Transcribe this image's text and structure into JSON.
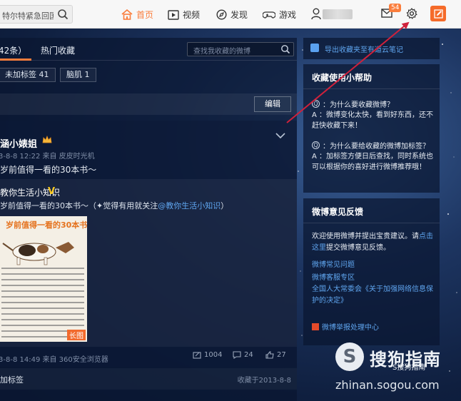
{
  "topbar": {
    "search_text": "特尔特紧急回国",
    "nav": {
      "home": "首页",
      "video": "视频",
      "discover": "发现",
      "game": "游戏"
    },
    "mail_badge": "54"
  },
  "main": {
    "tabs": [
      "42条）",
      "热门收藏"
    ],
    "fav_search_placeholder": "查找我收藏的微博",
    "tags": [
      "未加标签 41",
      "脑肌 1"
    ],
    "edit_label": "编辑",
    "post": {
      "author": "涵小婊姐",
      "meta": "3-8-8 12:22 来自 皮皮时光机",
      "text": "岁前值得一看的30本书～",
      "repost": {
        "author": "教你生活小知识",
        "v_badge": "V",
        "text_prefix": "岁前值得一看的30本书～（✦觉得有用就关注",
        "text_link": "@教你生活小知识",
        "text_suffix": "）",
        "thumb_title": "岁前值得一看的30本书",
        "long_tag": "长图"
      },
      "footer_meta": "3-8-8 14:49 来自 360安全浏览器",
      "repost_count": "1004",
      "comment_count": "24",
      "like_count": "27"
    },
    "tag_footer_left": "加标签",
    "tag_footer_right": "收藏于2013-8-8"
  },
  "sidebar": {
    "export_text": "导出收藏夹至有道云笔记",
    "help": {
      "title": "收藏使用小帮助",
      "q1": "：为什么要收藏微博？",
      "a1": "A ：微博变化太快，看到好东西，还不赶快收藏下来！",
      "q2": "：为什么要给收藏的微博加标签？",
      "a2": "A ：加标签方便日后查找，同时系统也可以根据你的喜好进行微博推荐哦！"
    },
    "feedback": {
      "title": "微博意见反馈",
      "text_prefix": "欢迎使用微博并提出宝贵建议。请",
      "text_link": "点击这里",
      "text_suffix": "提交微博意见反馈。",
      "link1": "微博常见问题",
      "link2": "微博客服专区",
      "law": "全国人大常委会《关于加强网络信息保护的决定》",
      "report": "微博举报处理中心"
    }
  },
  "watermark": {
    "logo": "S",
    "brand": "搜狗指南",
    "small": "S搜狗指南",
    "url": "zhinan.sogou.com"
  },
  "colors": {
    "accent": "#fa7d3c",
    "link": "#5fa5ef",
    "arrow": "#d0213b"
  }
}
